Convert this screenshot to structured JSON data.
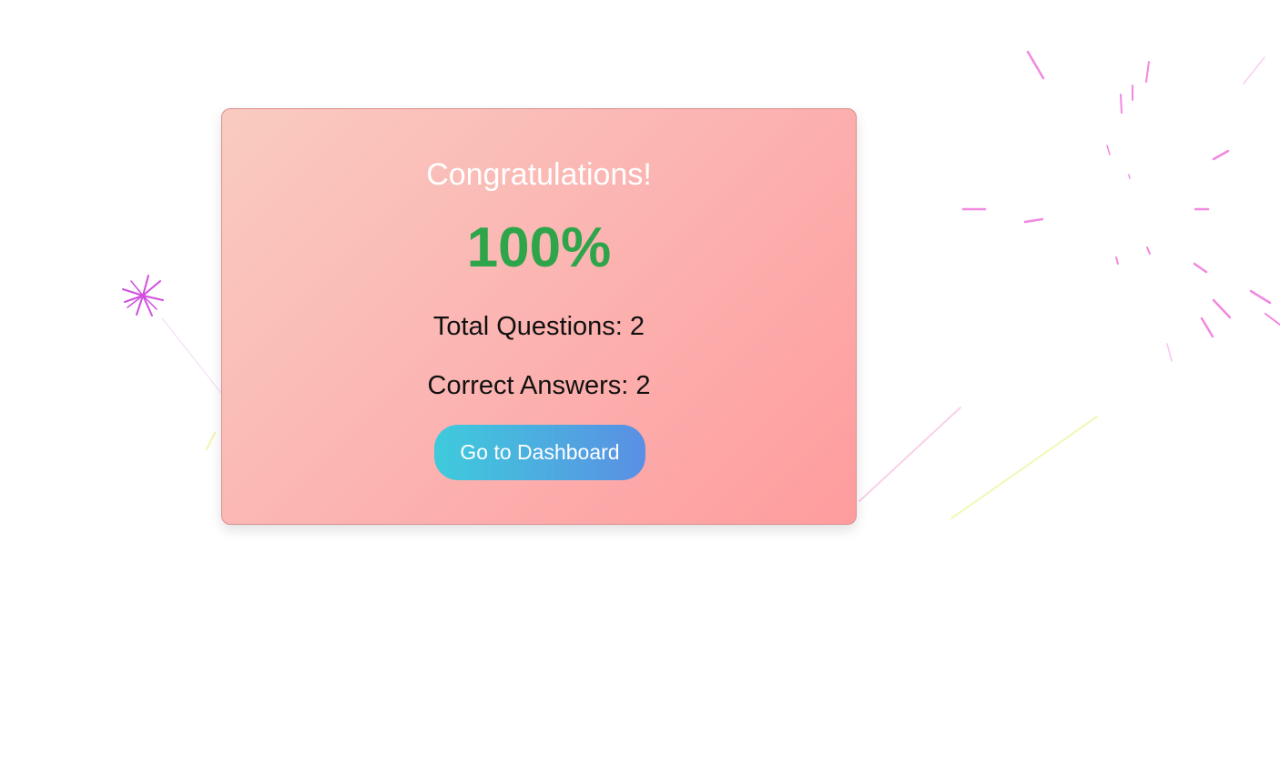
{
  "result": {
    "title": "Congratulations!",
    "score": "100%",
    "total_questions": "Total Questions: 2",
    "correct_answers": "Correct Answers: 2",
    "dashboard_button": "Go to Dashboard"
  },
  "colors": {
    "score": "#2ea54a",
    "title": "#ffffff",
    "card_gradient_start": "#f9cbc0",
    "card_gradient_end": "#ff9c9e",
    "button_gradient_start": "#3ecbdb",
    "button_gradient_end": "#5a8fe4",
    "firework_magenta": "#d24ee0",
    "firework_pink": "#f06ad8",
    "firework_yellow": "#e6f070"
  },
  "decorations": {
    "fireworks": [
      "firework-burst-left",
      "firework-burst-right"
    ]
  }
}
